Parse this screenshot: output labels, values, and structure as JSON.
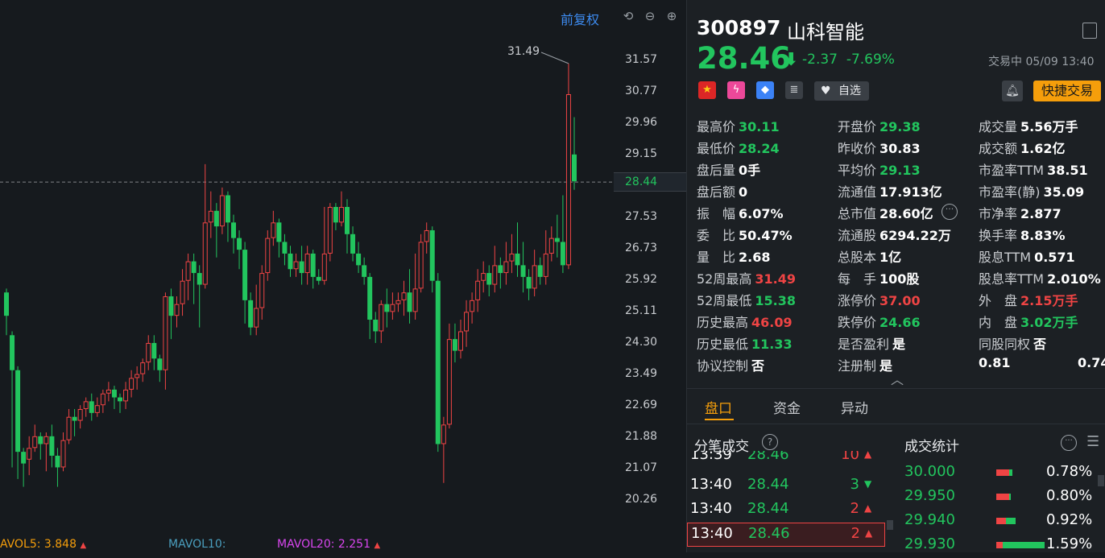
{
  "chart": {
    "fq_label": "前复权",
    "y_ticks": [
      "31.57",
      "30.77",
      "29.96",
      "29.15",
      "28.44",
      "27.53",
      "26.73",
      "25.92",
      "25.11",
      "24.30",
      "23.49",
      "22.69",
      "21.88",
      "21.07",
      "20.26"
    ],
    "current_price_label": "28.44",
    "peak_label": "31.49",
    "vol_legends": [
      {
        "label": "AVOL5: 3.848",
        "color": "#f59e0b"
      },
      {
        "label": "MAVOL10:",
        "color": "#4a9fbf"
      },
      {
        "label": "MAVOL20: 2.251",
        "color": "#d946ef"
      }
    ],
    "colors": {
      "up": "#ef4444",
      "down": "#22c55e",
      "bg": "#161a1e"
    }
  },
  "chart_data": {
    "type": "candlestick",
    "ylim": [
      20.26,
      31.57
    ],
    "candles": [
      [
        25.6,
        25.0,
        25.7,
        24.5
      ],
      [
        24.5,
        23.6,
        24.6,
        21.1
      ],
      [
        23.6,
        21.5,
        23.7,
        20.8
      ],
      [
        21.5,
        21.2,
        21.6,
        20.6
      ],
      [
        21.3,
        21.6,
        21.9,
        20.9
      ],
      [
        21.6,
        21.9,
        22.2,
        21.5
      ],
      [
        21.9,
        21.7,
        22.0,
        21.3
      ],
      [
        21.7,
        21.9,
        22.0,
        21.0
      ],
      [
        21.9,
        21.4,
        22.2,
        21.1
      ],
      [
        21.4,
        21.1,
        21.6,
        20.6
      ],
      [
        21.1,
        21.8,
        22.0,
        21.0
      ],
      [
        21.8,
        22.4,
        22.6,
        21.7
      ],
      [
        22.4,
        22.3,
        22.6,
        21.9
      ],
      [
        22.3,
        22.6,
        22.7,
        22.1
      ],
      [
        22.6,
        22.8,
        22.9,
        22.4
      ],
      [
        22.8,
        22.5,
        23.0,
        22.3
      ],
      [
        22.5,
        22.7,
        22.9,
        22.4
      ],
      [
        22.7,
        23.0,
        23.1,
        22.5
      ],
      [
        23.0,
        23.1,
        23.3,
        22.8
      ],
      [
        23.1,
        22.9,
        23.2,
        22.6
      ],
      [
        22.9,
        22.8,
        23.0,
        22.5
      ],
      [
        22.8,
        23.1,
        23.3,
        22.6
      ],
      [
        23.1,
        23.4,
        23.6,
        22.9
      ],
      [
        23.4,
        23.5,
        23.7,
        23.1
      ],
      [
        23.5,
        23.8,
        23.9,
        23.3
      ],
      [
        23.8,
        24.3,
        24.5,
        23.6
      ],
      [
        24.3,
        23.9,
        24.5,
        23.6
      ],
      [
        23.9,
        23.6,
        24.0,
        23.3
      ],
      [
        23.6,
        25.5,
        25.6,
        23.1
      ],
      [
        25.5,
        25.0,
        25.7,
        24.4
      ],
      [
        25.0,
        25.3,
        25.5,
        24.7
      ],
      [
        25.3,
        25.9,
        26.2,
        25.0
      ],
      [
        25.9,
        26.4,
        26.6,
        25.4
      ],
      [
        26.4,
        26.1,
        26.6,
        25.3
      ],
      [
        26.1,
        25.8,
        26.3,
        24.7
      ],
      [
        25.8,
        27.4,
        28.9,
        25.7
      ],
      [
        27.4,
        27.7,
        28.2,
        27.0
      ],
      [
        27.7,
        27.3,
        27.9,
        26.5
      ],
      [
        27.3,
        28.1,
        28.3,
        27.1
      ],
      [
        28.1,
        27.4,
        28.2,
        26.9
      ],
      [
        27.4,
        27.0,
        27.6,
        26.6
      ],
      [
        27.0,
        26.7,
        27.2,
        26.2
      ],
      [
        26.7,
        25.4,
        26.9,
        24.8
      ],
      [
        25.4,
        24.7,
        25.6,
        24.5
      ],
      [
        24.7,
        25.2,
        25.8,
        24.5
      ],
      [
        25.2,
        26.1,
        26.3,
        24.9
      ],
      [
        26.1,
        27.0,
        27.2,
        25.9
      ],
      [
        27.0,
        27.4,
        27.7,
        26.8
      ],
      [
        27.4,
        26.9,
        27.5,
        26.5
      ],
      [
        26.9,
        26.6,
        27.1,
        26.3
      ],
      [
        26.6,
        26.2,
        26.8,
        26.0
      ],
      [
        26.2,
        26.4,
        26.6,
        26.0
      ],
      [
        26.4,
        26.1,
        26.8,
        25.8
      ],
      [
        26.1,
        26.6,
        26.8,
        25.8
      ],
      [
        26.6,
        26.0,
        26.7,
        25.7
      ],
      [
        26.0,
        25.9,
        26.2,
        25.8
      ],
      [
        25.9,
        26.6,
        27.8,
        25.8
      ],
      [
        26.6,
        27.8,
        27.9,
        26.4
      ],
      [
        27.8,
        27.4,
        27.9,
        27.2
      ],
      [
        27.4,
        27.8,
        28.2,
        27.3
      ],
      [
        27.8,
        27.1,
        28.0,
        26.6
      ],
      [
        27.1,
        26.6,
        27.3,
        26.4
      ],
      [
        26.6,
        26.3,
        26.9,
        26.1
      ],
      [
        26.3,
        26.0,
        26.5,
        25.8
      ],
      [
        26.0,
        24.9,
        26.1,
        24.4
      ],
      [
        24.9,
        24.6,
        25.1,
        24.3
      ],
      [
        24.6,
        25.3,
        25.4,
        24.3
      ],
      [
        25.3,
        25.1,
        25.7,
        24.7
      ],
      [
        25.1,
        25.3,
        25.6,
        24.9
      ],
      [
        25.3,
        25.4,
        25.6,
        25.1
      ],
      [
        25.4,
        25.6,
        25.9,
        25.0
      ],
      [
        25.6,
        25.1,
        26.2,
        24.8
      ],
      [
        25.1,
        25.7,
        26.6,
        24.9
      ],
      [
        25.7,
        26.9,
        27.1,
        25.6
      ],
      [
        26.9,
        27.2,
        27.4,
        26.6
      ],
      [
        27.2,
        25.9,
        27.3,
        25.6
      ],
      [
        25.9,
        21.7,
        26.1,
        21.5
      ],
      [
        21.7,
        22.2,
        22.4,
        20.7
      ],
      [
        22.2,
        24.4,
        24.8,
        22.1
      ],
      [
        24.4,
        24.1,
        24.8,
        23.8
      ],
      [
        24.1,
        24.6,
        24.9,
        23.9
      ],
      [
        24.6,
        25.1,
        25.4,
        24.2
      ],
      [
        25.1,
        25.4,
        25.6,
        24.8
      ],
      [
        25.4,
        25.9,
        26.2,
        25.1
      ],
      [
        25.9,
        26.1,
        26.4,
        25.6
      ],
      [
        26.1,
        25.8,
        26.3,
        25.5
      ],
      [
        25.8,
        26.3,
        26.8,
        25.6
      ],
      [
        26.3,
        26.1,
        26.5,
        25.7
      ],
      [
        26.1,
        26.4,
        26.9,
        25.8
      ],
      [
        26.4,
        26.6,
        27.1,
        26.1
      ],
      [
        26.6,
        26.3,
        27.4,
        26.0
      ],
      [
        26.3,
        26.0,
        26.9,
        25.6
      ],
      [
        26.0,
        25.7,
        26.2,
        25.4
      ],
      [
        25.7,
        26.3,
        26.7,
        25.5
      ],
      [
        26.3,
        26.0,
        26.5,
        25.8
      ],
      [
        26.0,
        26.6,
        27.2,
        25.8
      ],
      [
        26.6,
        27.0,
        27.3,
        26.4
      ],
      [
        27.0,
        26.9,
        27.6,
        26.5
      ],
      [
        26.9,
        26.3,
        28.1,
        26.1
      ],
      [
        26.3,
        30.7,
        31.49,
        26.2
      ],
      [
        29.15,
        28.46,
        30.11,
        28.24
      ]
    ]
  },
  "info": {
    "code": "300897",
    "name": "山科智能",
    "price": "28.46",
    "change": "-2.37",
    "change_pct": "-7.69%",
    "status": "交易中 05/09 13:40",
    "fav_label": "自选",
    "quick_trade_label": "快捷交易",
    "stats": [
      [
        {
          "k": "最高价",
          "v": "30.11",
          "c": "g"
        },
        {
          "k": "开盘价",
          "v": "29.38",
          "c": "g"
        },
        {
          "k": "成交量",
          "v": "5.56万手",
          "c": "w"
        }
      ],
      [
        {
          "k": "最低价",
          "v": "28.24",
          "c": "g"
        },
        {
          "k": "昨收价",
          "v": "30.83",
          "c": "w"
        },
        {
          "k": "成交额",
          "v": "1.62亿",
          "c": "w"
        }
      ],
      [
        {
          "k": "盘后量",
          "v": "0手",
          "c": "w"
        },
        {
          "k": "平均价",
          "v": "29.13",
          "c": "g"
        },
        {
          "k": "市盈率TTM",
          "v": "38.51",
          "c": "w"
        }
      ],
      [
        {
          "k": "盘后额",
          "v": "0",
          "c": "w"
        },
        {
          "k": "流通值",
          "v": "17.913亿",
          "c": "w"
        },
        {
          "k": "市盈率(静)",
          "v": "35.09",
          "c": "w"
        }
      ],
      [
        {
          "k": "振　幅",
          "v": "6.07%",
          "c": "w"
        },
        {
          "k": "总市值",
          "v": "28.60亿",
          "c": "w"
        },
        {
          "k": "市净率",
          "v": "2.877",
          "c": "w"
        }
      ],
      [
        {
          "k": "委　比",
          "v": "50.47%",
          "c": "w"
        },
        {
          "k": "流通股",
          "v": "6294.22万",
          "c": "w"
        },
        {
          "k": "换手率",
          "v": "8.83%",
          "c": "w"
        }
      ],
      [
        {
          "k": "量　比",
          "v": "2.68",
          "c": "w"
        },
        {
          "k": "总股本",
          "v": "1亿",
          "c": "w"
        },
        {
          "k": "股息TTM",
          "v": "0.571",
          "c": "w"
        }
      ],
      [
        {
          "k": "52周最高",
          "v": "31.49",
          "c": "r"
        },
        {
          "k": "每　手",
          "v": "100股",
          "c": "w"
        },
        {
          "k": "股息率TTM",
          "v": "2.010%",
          "c": "w"
        }
      ],
      [
        {
          "k": "52周最低",
          "v": "15.38",
          "c": "g"
        },
        {
          "k": "涨停价",
          "v": "37.00",
          "c": "r"
        },
        {
          "k": "外　盘",
          "v": "2.15万手",
          "c": "r"
        }
      ],
      [
        {
          "k": "历史最高",
          "v": "46.09",
          "c": "r"
        },
        {
          "k": "跌停价",
          "v": "24.66",
          "c": "g"
        },
        {
          "k": "内　盘",
          "v": "3.02万手",
          "c": "g"
        }
      ],
      [
        {
          "k": "历史最低",
          "v": "11.33",
          "c": "g"
        },
        {
          "k": "是否盈利",
          "v": "是",
          "c": "w"
        },
        {
          "k": "同股同权",
          "v": "否",
          "c": "w"
        }
      ],
      [
        {
          "k": "协议控制",
          "v": "否",
          "c": "w"
        },
        {
          "k": "注册制",
          "v": "是",
          "c": "w"
        },
        {
          "k": "0.81",
          "v": "0.74",
          "c": "w"
        }
      ]
    ],
    "tabs": [
      "盘口",
      "资金",
      "异动"
    ],
    "ticks_title": "分笔成交",
    "stats_title": "成交统计",
    "ticks": [
      {
        "t": "13:39",
        "p": "28.46",
        "q": "10",
        "dir": "up"
      },
      {
        "t": "13:40",
        "p": "28.44",
        "q": "3",
        "dir": "down"
      },
      {
        "t": "13:40",
        "p": "28.44",
        "q": "2",
        "dir": "up"
      },
      {
        "t": "13:40",
        "p": "28.46",
        "q": "2",
        "dir": "up"
      }
    ],
    "trade_stats": [
      {
        "price": "30.000",
        "pct": "0.78%",
        "red": 0.04,
        "green": 0.01
      },
      {
        "price": "29.950",
        "pct": "0.80%",
        "red": 0.04,
        "green": 0.005
      },
      {
        "price": "29.940",
        "pct": "0.92%",
        "red": 0.03,
        "green": 0.03
      },
      {
        "price": "29.930",
        "pct": "1.59%",
        "red": 0.02,
        "green": 0.13
      }
    ]
  }
}
